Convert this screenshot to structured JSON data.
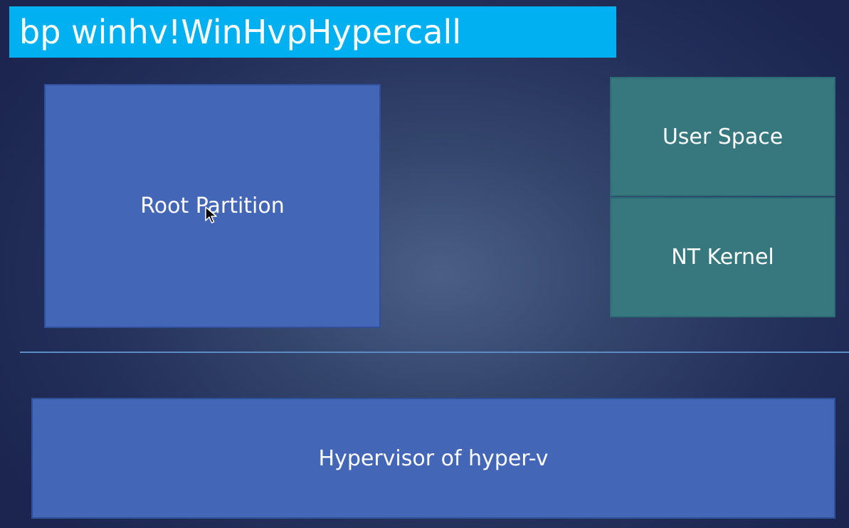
{
  "title": "bp winhv!WinHvpHypercall",
  "boxes": {
    "root_partition": "Root Partition",
    "user_space": "User Space",
    "nt_kernel": "NT Kernel",
    "hypervisor": "Hypervisor of hyper-v"
  },
  "colors": {
    "banner": "#00b0f0",
    "partition_blue": "#4366b6",
    "guest_teal": "#37787f"
  }
}
